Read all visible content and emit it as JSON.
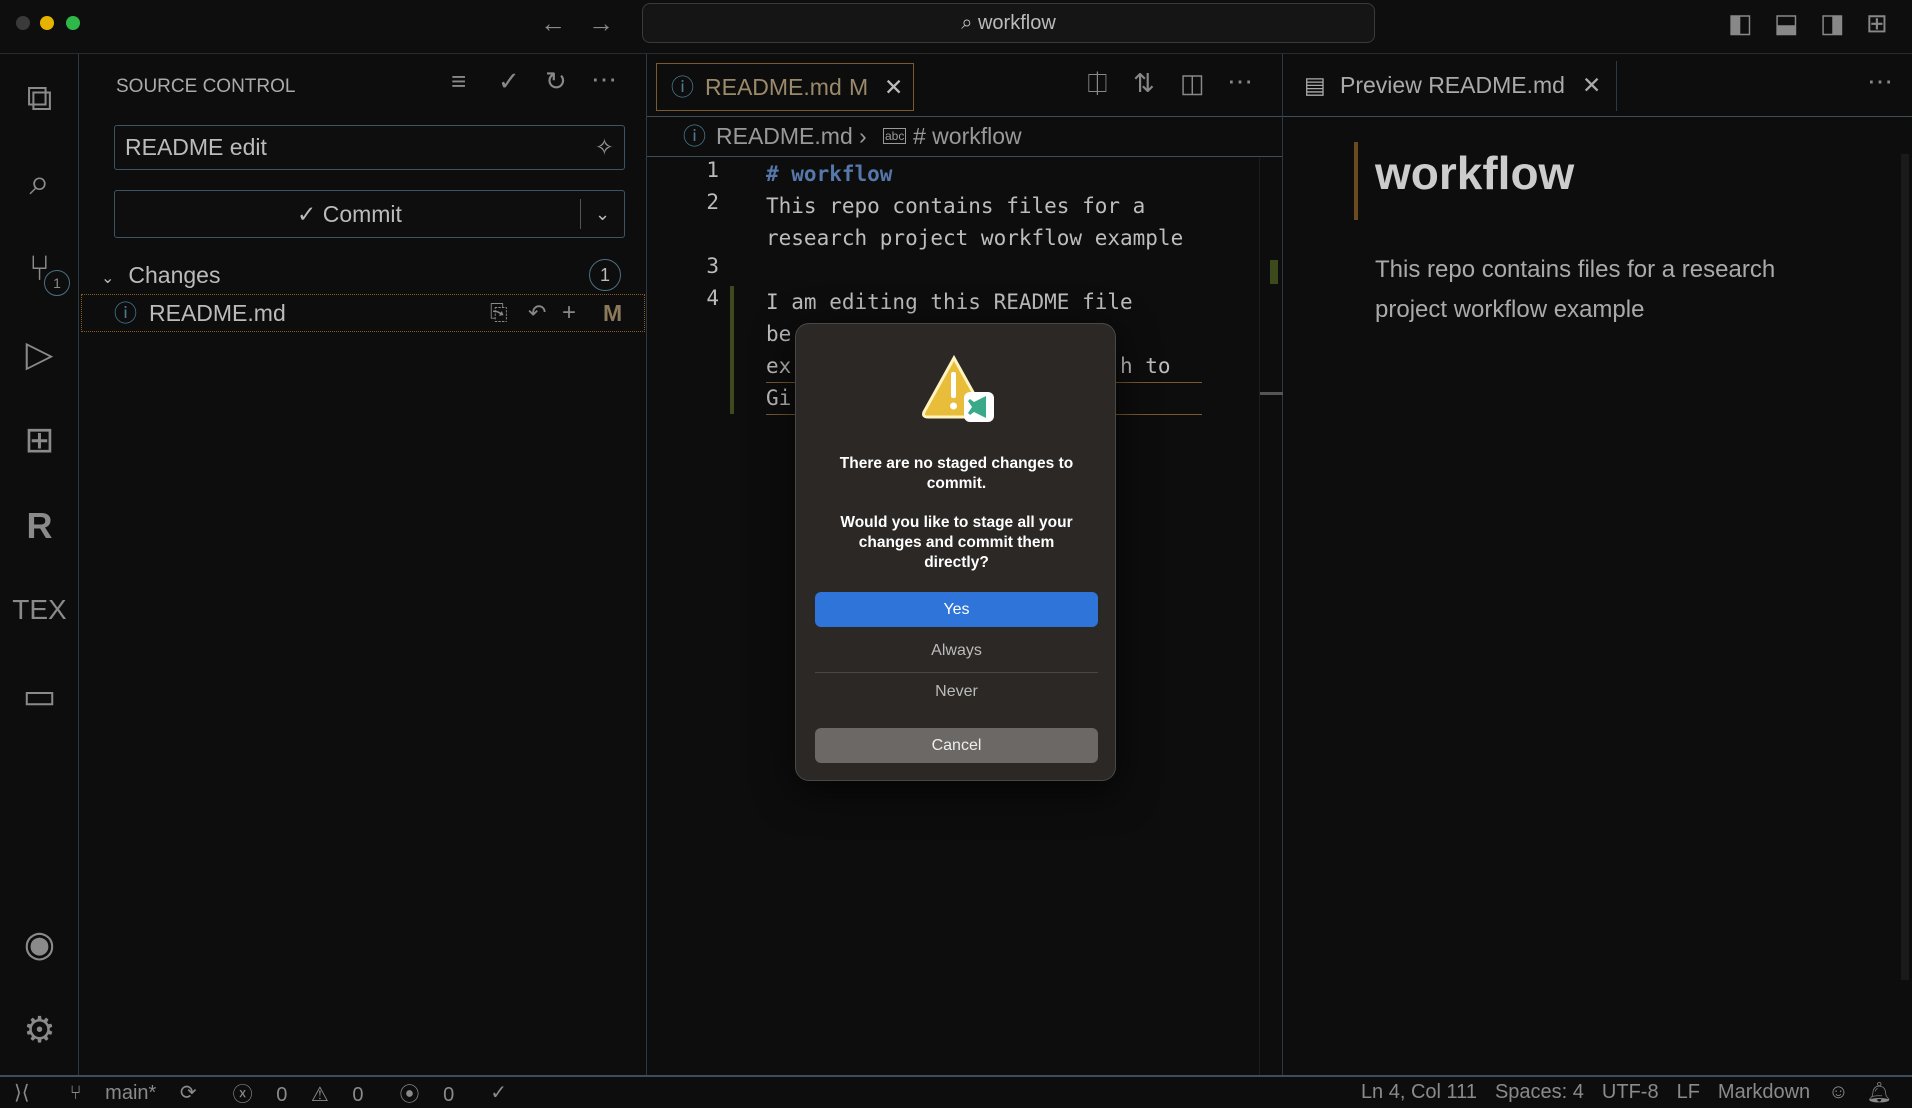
{
  "titlebar": {
    "search": "workflow"
  },
  "activity": {
    "scm_badge": "1"
  },
  "sidebar": {
    "title": "SOURCE CONTROL",
    "commit_message": "README edit",
    "commit_label": "✓ Commit",
    "changes_label": "Changes",
    "changes_count": "1",
    "file": {
      "name": "README.md",
      "status": "M"
    }
  },
  "editor": {
    "tab": {
      "name": "README.md",
      "status": "M"
    },
    "breadcrumb": {
      "file": "README.md",
      "symbol": "# workflow"
    },
    "lines": [
      {
        "num": "1",
        "text": "# workflow"
      },
      {
        "num": "2",
        "text": "This repo contains files for a"
      },
      {
        "num": "",
        "text": "research project workflow example"
      },
      {
        "num": "3",
        "text": ""
      },
      {
        "num": "4",
        "text": "I am editing this README file"
      },
      {
        "num": "",
        "text": "be"
      },
      {
        "num": "",
        "text": "ex                          h to"
      },
      {
        "num": "",
        "text": "Gi"
      }
    ]
  },
  "preview": {
    "tab": "Preview README.md",
    "heading": "workflow",
    "body": "This repo contains files for a research project workflow example"
  },
  "dialog": {
    "title": "There are no staged changes to commit.",
    "message": "Would you like to stage all your changes and commit them directly?",
    "yes": "Yes",
    "always": "Always",
    "never": "Never",
    "cancel": "Cancel"
  },
  "status": {
    "branch": "main*",
    "errors": "0",
    "warnings": "0",
    "ports": "0",
    "position": "Ln 4, Col 111",
    "spaces": "Spaces: 4",
    "encoding": "UTF-8",
    "eol": "LF",
    "language": "Markdown"
  },
  "colors": {
    "accent": "#2f74d9",
    "modified": "#9a8a6a",
    "heading": "#5577aa"
  }
}
